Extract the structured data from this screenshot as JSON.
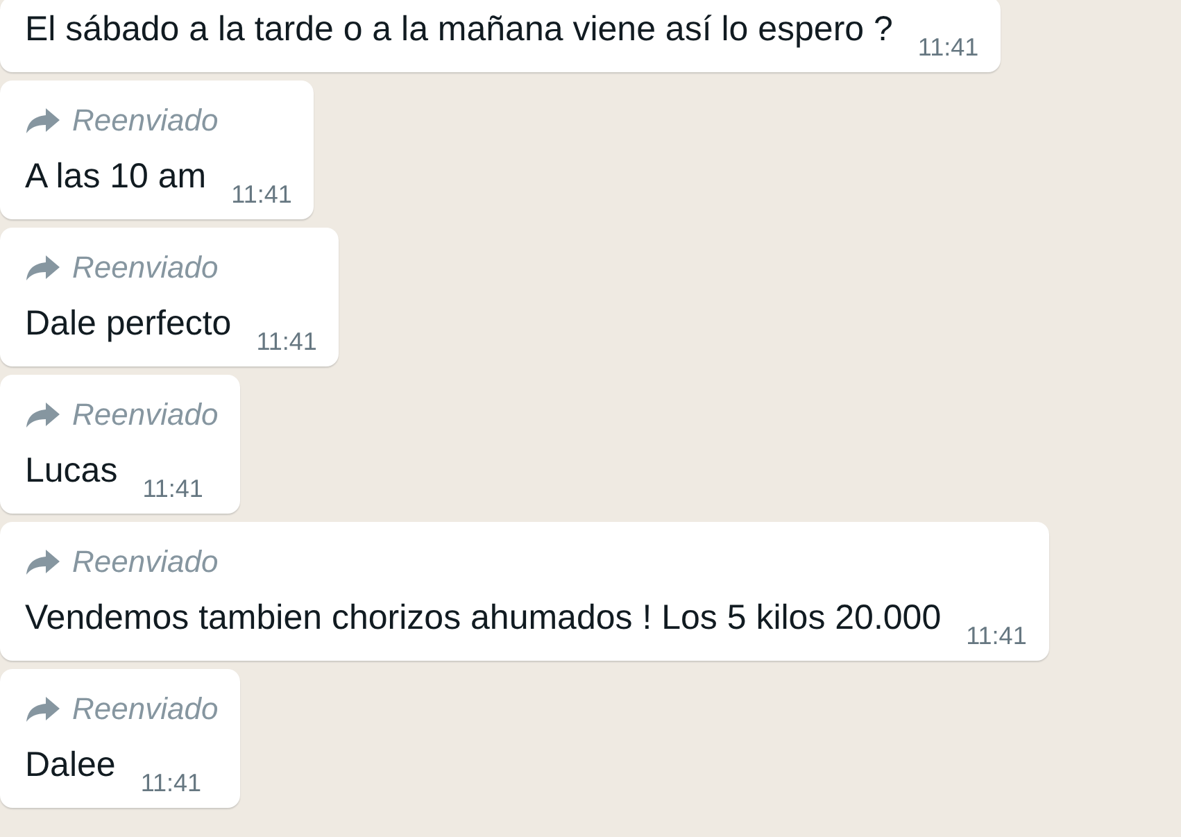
{
  "messages": [
    {
      "forwarded": false,
      "text": "El sábado a la tarde o a la mañana viene así lo espero ?",
      "time": "11:41"
    },
    {
      "forwarded": true,
      "forwarded_label": "Reenviado",
      "text": "A las 10 am",
      "time": "11:41"
    },
    {
      "forwarded": true,
      "forwarded_label": "Reenviado",
      "text": "Dale perfecto",
      "time": "11:41"
    },
    {
      "forwarded": true,
      "forwarded_label": "Reenviado",
      "text": "Lucas",
      "time": "11:41"
    },
    {
      "forwarded": true,
      "forwarded_label": "Reenviado",
      "text": "Vendemos tambien chorizos ahumados ! Los 5 kilos 20.000",
      "time": "11:41"
    },
    {
      "forwarded": true,
      "forwarded_label": "Reenviado",
      "text": "Dalee",
      "time": "11:41"
    }
  ]
}
